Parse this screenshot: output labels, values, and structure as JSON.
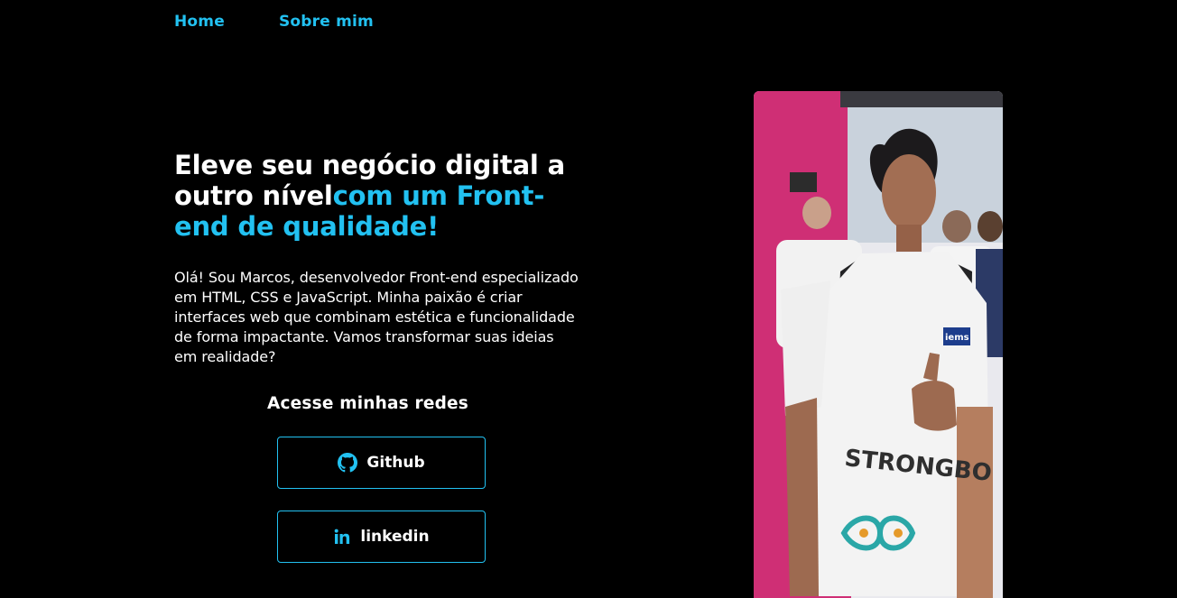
{
  "nav": {
    "items": [
      {
        "label": "Home"
      },
      {
        "label": "Sobre mim"
      }
    ]
  },
  "hero": {
    "title_white": "Eleve seu negócio digital a outro nível",
    "title_accent": "com um Front-end de qualidade!",
    "description": "Olá! Sou Marcos, desenvolvedor Front-end especializado em HTML, CSS e JavaScript. Minha paixão é criar interfaces web que combinam estética e funcionalidade de forma impactante. Vamos transformar suas ideias em realidade?"
  },
  "socials": {
    "title": "Acesse minhas redes",
    "buttons": [
      {
        "label": "Github",
        "icon": "github-icon"
      },
      {
        "label": "linkedin",
        "icon": "linkedin-icon"
      }
    ]
  },
  "photo": {
    "shirt_text": "STRONGBO",
    "badge_text": "iems"
  },
  "colors": {
    "background": "#000000",
    "accent": "#22c1f1",
    "text": "#ffffff"
  }
}
